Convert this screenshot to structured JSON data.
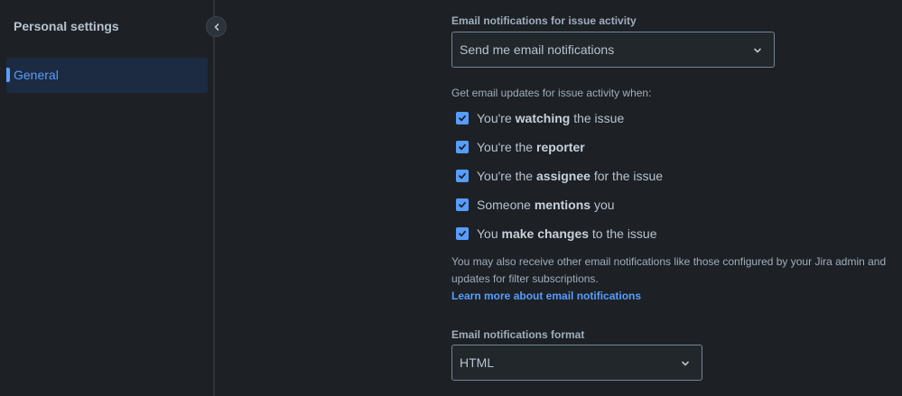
{
  "sidebar": {
    "title": "Personal settings",
    "items": [
      {
        "label": "General",
        "active": true
      }
    ]
  },
  "email_activity": {
    "label": "Email notifications for issue activity",
    "selected": "Send me email notifications"
  },
  "updates": {
    "intro": "Get email updates for issue activity when:",
    "options": [
      {
        "pre": "You're ",
        "bold": "watching",
        "post": " the issue",
        "checked": true
      },
      {
        "pre": "You're the ",
        "bold": "reporter",
        "post": "",
        "checked": true
      },
      {
        "pre": "You're the ",
        "bold": "assignee",
        "post": " for the issue",
        "checked": true
      },
      {
        "pre": "Someone ",
        "bold": "mentions",
        "post": " you",
        "checked": true
      },
      {
        "pre": "You ",
        "bold": "make changes",
        "post": " to the issue",
        "checked": true
      }
    ]
  },
  "note": "You may also receive other email notifications like those configured by your Jira admin and updates for filter subscriptions.",
  "learn_more": "Learn more about email notifications",
  "format": {
    "label": "Email notifications format",
    "selected": "HTML"
  },
  "colors": {
    "accent": "#579dff",
    "background": "#1d2125",
    "nav_active_bg": "#1c2b41"
  }
}
